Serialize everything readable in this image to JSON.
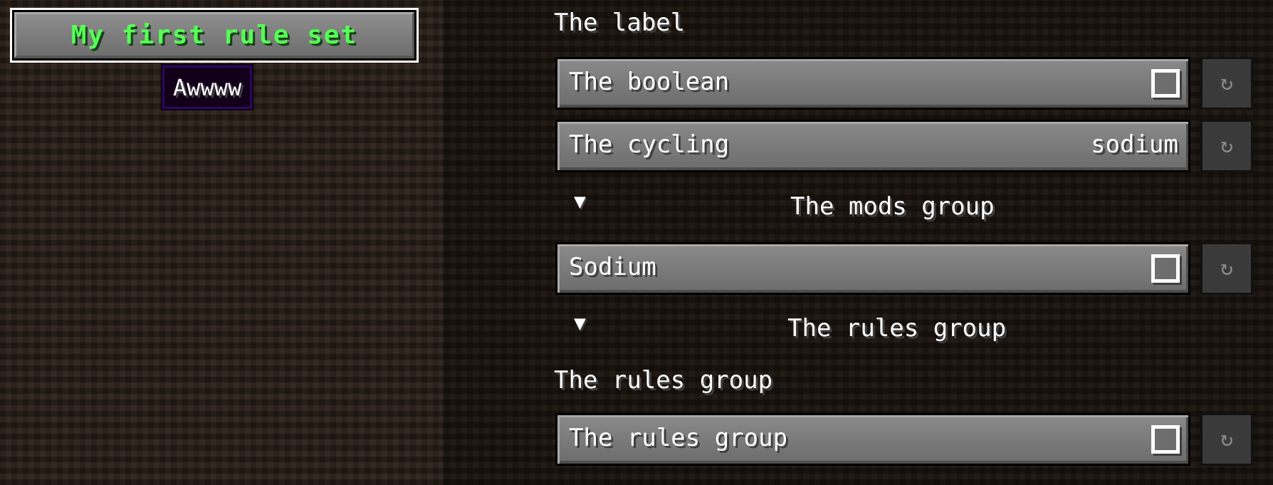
{
  "title_button": {
    "label": "My first rule set",
    "color": "#55ff55"
  },
  "tooltip": {
    "text": "Awwww"
  },
  "right_list": {
    "heading_label": "The label",
    "boolean_row": {
      "label": "The boolean",
      "checkbox_icon": "checkbox-icon"
    },
    "cycling_row": {
      "label": "The cycling",
      "value": "sodium"
    },
    "mods_group": {
      "toggle_icon": "▼",
      "label": "The mods group"
    },
    "sodium_row": {
      "label": "Sodium"
    },
    "rules_group": {
      "toggle_icon": "▼",
      "label": "The rules group"
    },
    "rules_heading": "The rules group",
    "rules_row": {
      "label": "The rules group"
    },
    "reset_icon": "↻"
  }
}
